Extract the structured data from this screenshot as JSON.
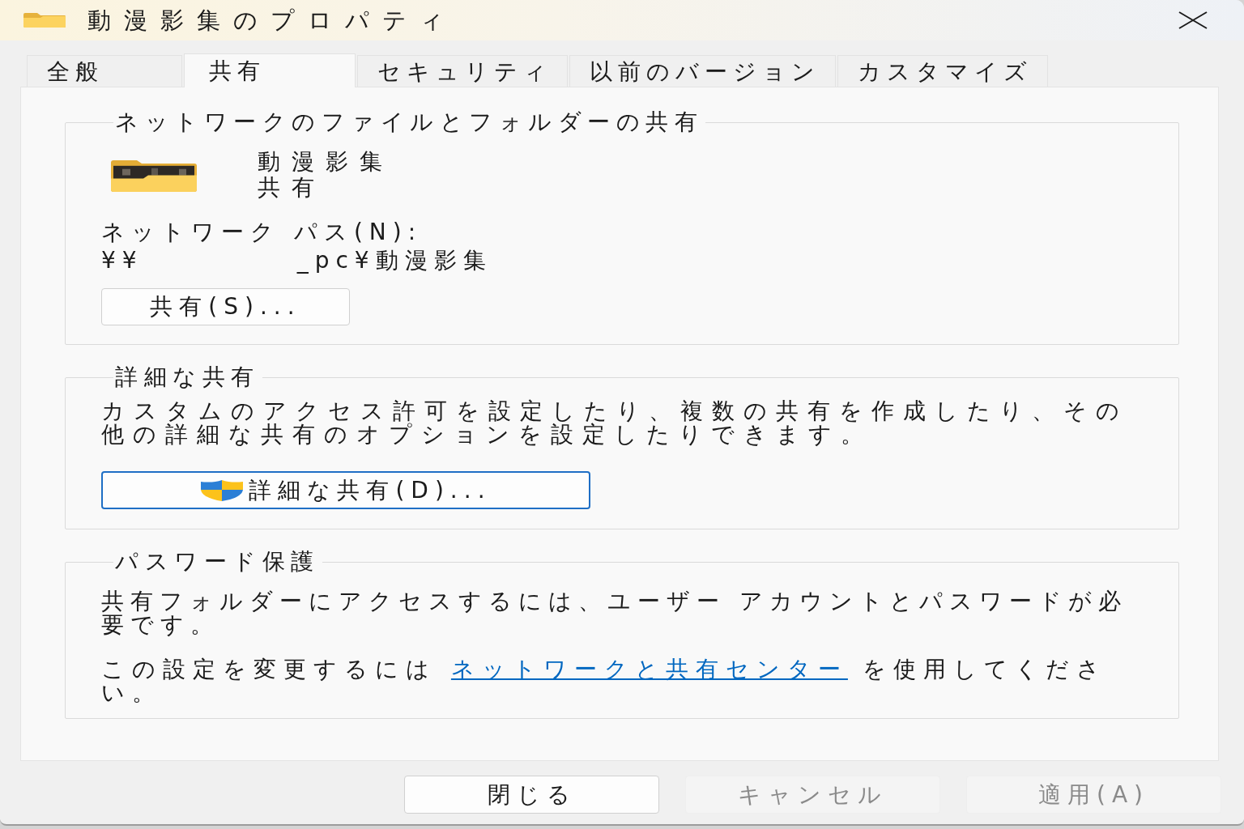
{
  "window": {
    "title": "動漫影集のプロパティ"
  },
  "tabs": [
    {
      "label": "全般",
      "selected": false
    },
    {
      "label": "共有",
      "selected": true
    },
    {
      "label": "セキュリティ",
      "selected": false
    },
    {
      "label": "以前のバージョン",
      "selected": false
    },
    {
      "label": "カスタマイズ",
      "selected": false
    }
  ],
  "network_sharing": {
    "title": "ネットワークのファイルとフォルダーの共有",
    "folder_name": "動漫影集",
    "share_status": "共有",
    "path_label": "ネットワーク パス(N):",
    "network_path": {
      "start": "¥¥",
      "end": "_pc¥動漫影集"
    },
    "button": {
      "label": "共有(S)...",
      "focused": false
    }
  },
  "advanced_sharing": {
    "title": "詳細な共有",
    "description": "カスタムのアクセス許可を設定したり、複数の共有を作成したり、その他の詳細な共有のオプションを設定したりできます。",
    "button": {
      "label": "詳細な共有(D)...",
      "focused": true
    }
  },
  "password_protection": {
    "title": "パスワード保護",
    "description": "共有フォルダーにアクセスするには、ユーザー アカウントとパスワードが必要です。",
    "change_hint": {
      "before": "この設定を変更するには ",
      "link": "ネットワークと共有センター",
      "after": " を使用してください。"
    }
  },
  "buttons": [
    {
      "label": "閉じる",
      "disabled": false
    },
    {
      "label": "キャンセル",
      "disabled": true
    },
    {
      "label": "適用(A)",
      "disabled": true
    }
  ]
}
